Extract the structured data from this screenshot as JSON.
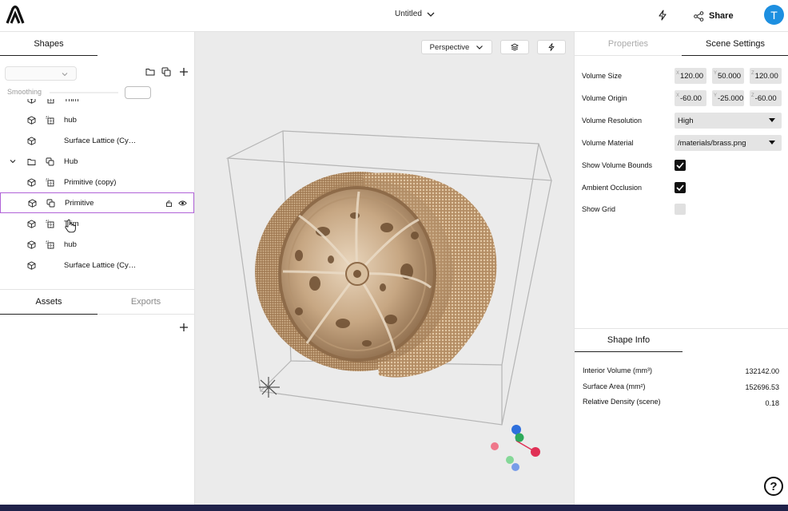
{
  "header": {
    "document_title": "Untitled",
    "share_label": "Share",
    "avatar_initial": "T"
  },
  "left_panel": {
    "tab_shapes": "Shapes",
    "smoothing_label": "Smoothing",
    "tree": [
      {
        "label": "Trim",
        "icon_type": "lattice",
        "expandable": false
      },
      {
        "label": "hub",
        "icon_type": "lattice",
        "expandable": false
      },
      {
        "label": "Surface Lattice (Cy…",
        "icon_type": "none",
        "expandable": false
      },
      {
        "label": "Hub",
        "icon_type": "folder",
        "expandable": true
      },
      {
        "label": "Primitive (copy)",
        "icon_type": "lattice",
        "expandable": false
      },
      {
        "label": "Primitive",
        "icon_type": "copy",
        "expandable": false,
        "selected": true
      },
      {
        "label": "Trim",
        "icon_type": "lattice",
        "expandable": false
      },
      {
        "label": "hub",
        "icon_type": "lattice",
        "expandable": false
      },
      {
        "label": "Surface Lattice (Cy…",
        "icon_type": "none",
        "expandable": false
      }
    ],
    "tab_assets": "Assets",
    "tab_exports": "Exports"
  },
  "viewport": {
    "camera_mode": "Perspective"
  },
  "right_panel": {
    "tab_properties": "Properties",
    "tab_scene_settings": "Scene Settings",
    "volume_size_label": "Volume Size",
    "volume_size": {
      "x": "120.00",
      "y": "50.000",
      "z": "120.00"
    },
    "volume_origin_label": "Volume Origin",
    "volume_origin": {
      "x": "-60.00",
      "y": "-25.000",
      "z": "-60.00"
    },
    "volume_resolution_label": "Volume Resolution",
    "volume_resolution_value": "High",
    "volume_material_label": "Volume Material",
    "volume_material_value": "/materials/brass.png",
    "show_volume_bounds_label": "Show Volume Bounds",
    "show_volume_bounds": true,
    "ambient_occlusion_label": "Ambient Occlusion",
    "ambient_occlusion": true,
    "show_grid_label": "Show Grid",
    "show_grid": false,
    "tab_shape_info": "Shape Info",
    "info": [
      {
        "label": "Interior Volume (mm³)",
        "value": "132142.00"
      },
      {
        "label": "Surface Area (mm²)",
        "value": "152696.53"
      },
      {
        "label": "Relative Density (scene)",
        "value": "0.18"
      }
    ],
    "help_label": "?"
  },
  "colors": {
    "accent_selection": "#b063d8",
    "avatar_blue": "#1d8fe0",
    "brass": "#b89a78",
    "viewport_bg": "#ebebeb"
  }
}
